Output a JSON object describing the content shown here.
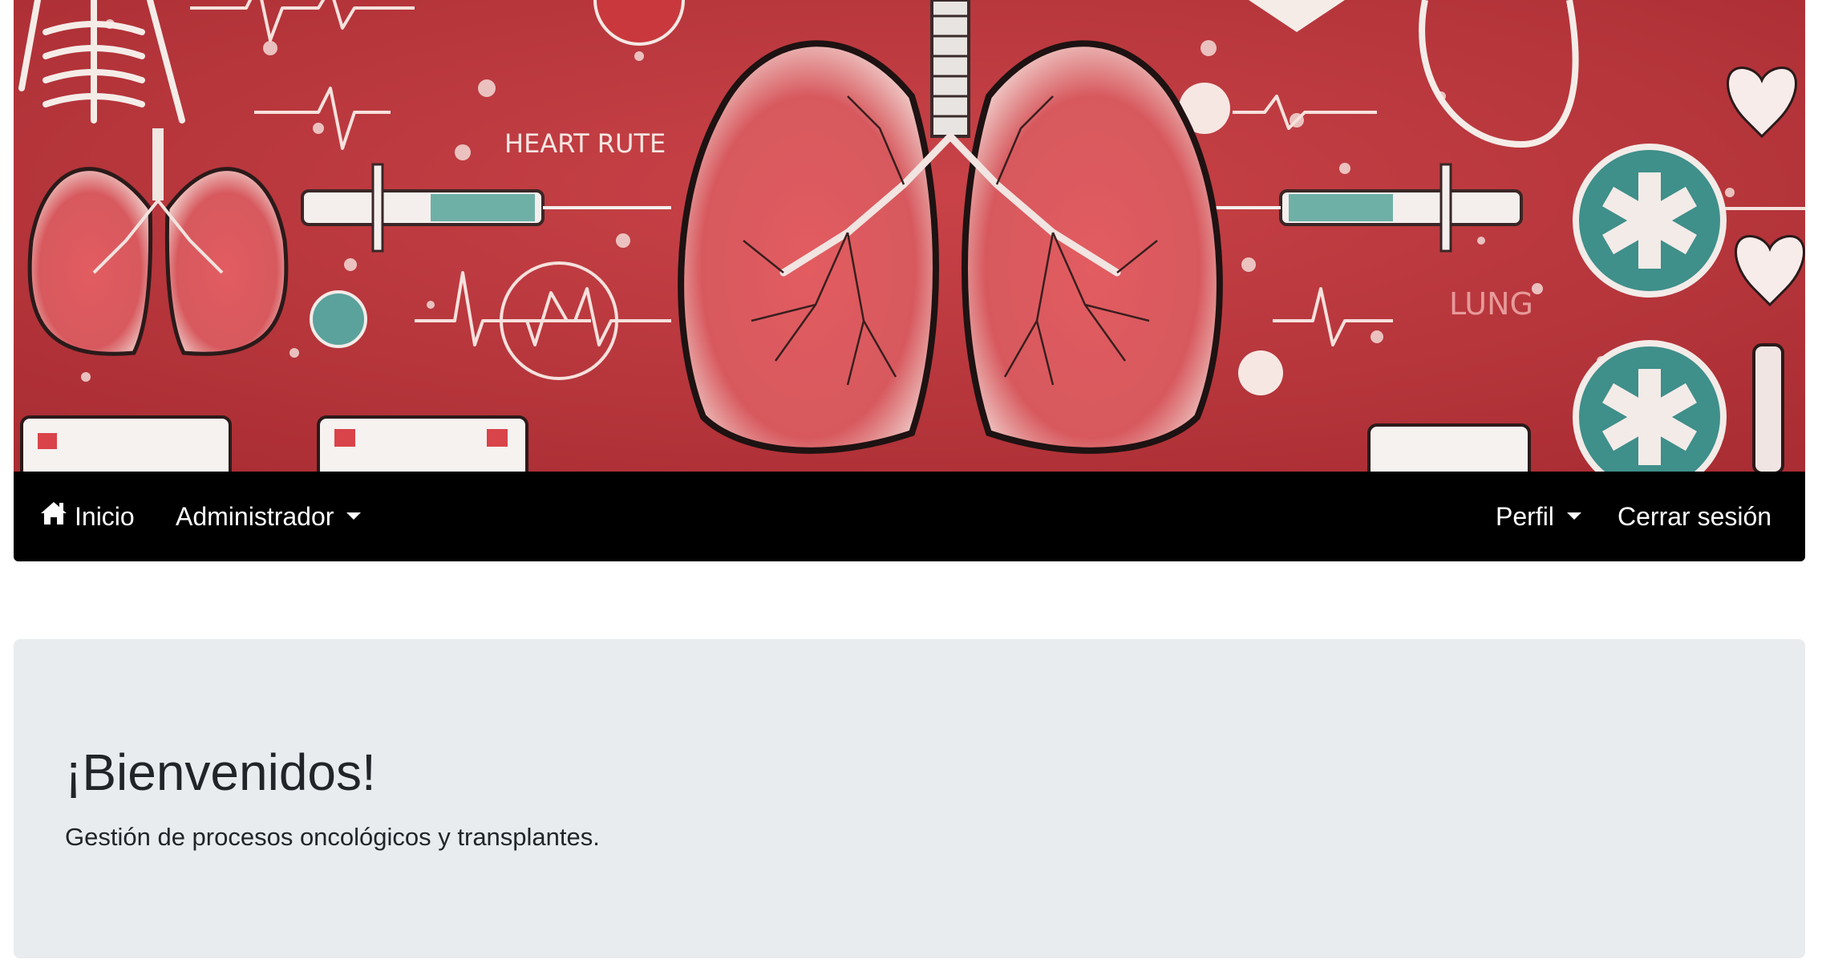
{
  "banner": {
    "image_texts": {
      "heart_rate": "HEART RUTE",
      "lung": "LUNG"
    },
    "colors": {
      "background": "#b8343a",
      "lung": "#d9545a",
      "outline": "#2b1a1a",
      "accent_teal": "#3f8f8a"
    }
  },
  "navbar": {
    "home": {
      "label": "Inicio",
      "icon": "home-icon"
    },
    "admin": {
      "label": "Administrador",
      "icon": "caret-down-icon"
    },
    "perfil": {
      "label": "Perfil",
      "icon": "caret-down-icon"
    },
    "logout": {
      "label": "Cerrar sesión"
    },
    "background": "#000000"
  },
  "jumbotron": {
    "title": "¡Bienvenidos!",
    "subtitle": "Gestión de procesos oncológicos y transplantes.",
    "background": "#e9ecef"
  }
}
